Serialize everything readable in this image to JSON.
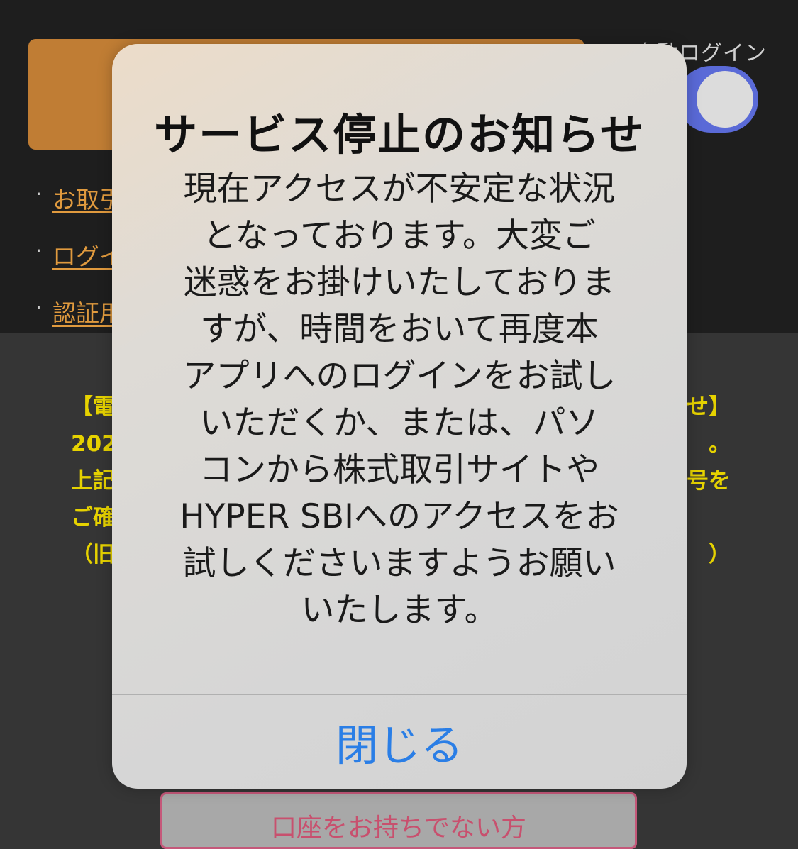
{
  "background": {
    "autologin_label": "自動ログイン",
    "autologin_enabled": true,
    "links": [
      "お取引",
      "ログイン",
      "認証用"
    ],
    "notice_lines": [
      {
        "left": "【電",
        "right": "せ】"
      },
      {
        "left": "202",
        "right": "。"
      },
      {
        "left": "上記",
        "right": "号を"
      },
      {
        "left": "ご確",
        "right": ""
      },
      {
        "left": "（旧",
        "right": "）"
      }
    ],
    "bottom_button_label": "口座をお持ちでない方"
  },
  "dialog": {
    "title": "サービス停止のお知らせ",
    "message_lines": [
      "現在アクセスが不安定な状況",
      "となっております。大変ご",
      "迷惑をお掛けいたしておりま",
      "すが、時間をおいて再度本",
      "アプリへのログインをお試し",
      "いただくか、または、パソ",
      "コンから株式取引サイトや",
      "HYPER SBIへのアクセスをお",
      "試しくださいますようお願い",
      "いたします。"
    ],
    "close_label": "閉じる"
  },
  "colors": {
    "accent_orange": "#c07d34",
    "toggle_blue": "#5a6ad7",
    "link_orange": "#e09a3e",
    "notice_yellow": "#e6d200",
    "ios_blue": "#2a7ee6"
  }
}
